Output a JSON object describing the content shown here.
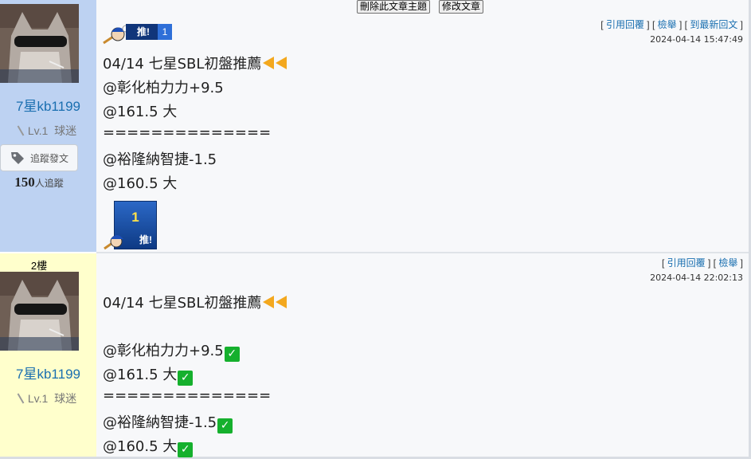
{
  "toolbar": {
    "delete_topic": "刪除此文章主題",
    "edit_post": "修改文章"
  },
  "post1": {
    "user": {
      "name": "7星kb1199",
      "level": "Lv.1",
      "rank": "球迷",
      "track_label": "追蹤發文",
      "followers_count": "150",
      "followers_suffix": "人追蹤"
    },
    "links": {
      "quote": "引用回覆",
      "report": "檢舉",
      "latest": "到最新回文"
    },
    "timestamp": "2024-04-14 15:47:49",
    "push_badge": {
      "label": "推!",
      "count": "1"
    },
    "lines": [
      "04/14 七星SBL初盤推薦",
      "@彰化柏力力+9.5",
      "@161.5 大",
      "==============",
      "@裕隆納智捷-1.5",
      "@160.5 大"
    ],
    "push_box": {
      "count": "1",
      "label": "推!"
    }
  },
  "post2": {
    "floor": "2樓",
    "user": {
      "name": "7星kb1199",
      "level": "Lv.1",
      "rank": "球迷"
    },
    "links": {
      "quote": "引用回覆",
      "report": "檢舉"
    },
    "timestamp": "2024-04-14 22:02:13",
    "lines": [
      "04/14 七星SBL初盤推薦",
      "@彰化柏力力+9.5",
      "@161.5 大",
      "==============",
      "@裕隆納智捷-1.5",
      "@160.5 大"
    ]
  },
  "colors": {
    "username": "#1a6fb0",
    "sidebar_blue": "#bdd2f2",
    "sidebar_yellow": "#ffffcc",
    "check_green": "#15b02d",
    "push_blue": "#1e4fa3"
  }
}
